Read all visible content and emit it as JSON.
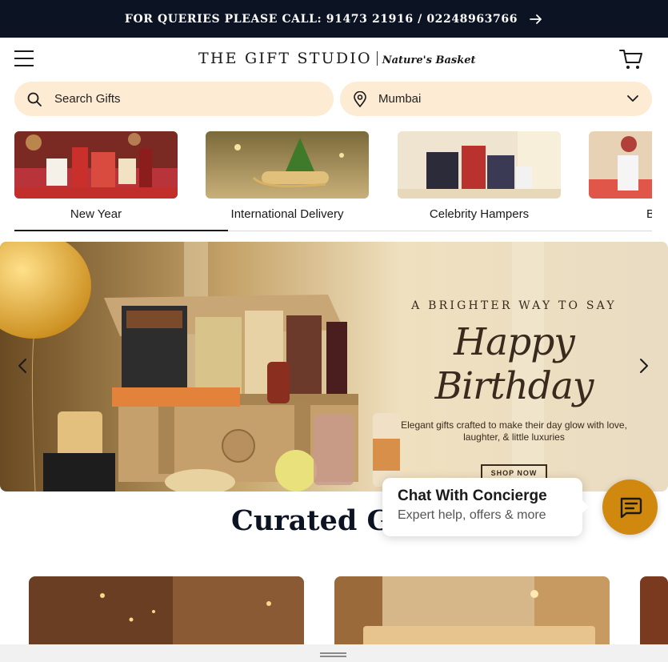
{
  "topbar": {
    "text": "FOR QUERIES PLEASE CALL: 91473 21916 / 02248963766",
    "arrow_icon": "arrow-right-icon"
  },
  "header": {
    "logo_main": "THE GIFT STUDIO",
    "logo_sub": "Nature's Basket",
    "menu_icon": "hamburger-menu-icon",
    "cart_icon": "cart-icon"
  },
  "search": {
    "placeholder": "Search Gifts",
    "icon": "search-icon"
  },
  "location": {
    "value": "Mumbai",
    "icon": "location-pin-icon",
    "chevron": "chevron-down-icon"
  },
  "categories": [
    {
      "label": "New Year",
      "active": true
    },
    {
      "label": "International Delivery"
    },
    {
      "label": "Celebrity Hampers"
    },
    {
      "label": "B"
    }
  ],
  "hero": {
    "tagline": "A BRIGHTER WAY TO SAY",
    "headline": "Happy Birthday",
    "description": "Elegant gifts crafted to make their day glow with love, laughter, & little luxuries",
    "cta": "SHOP NOW",
    "prev_icon": "chevron-left-icon",
    "next_icon": "chevron-right-icon"
  },
  "section": {
    "title": "Curated G"
  },
  "chat": {
    "title": "Chat With Concierge",
    "subtitle": "Expert help, offers & more",
    "icon": "chat-icon"
  },
  "colors": {
    "topbar_bg": "#0c1424",
    "input_bg": "#fdebd3",
    "accent": "#d0880f",
    "heading": "#0c1424"
  }
}
